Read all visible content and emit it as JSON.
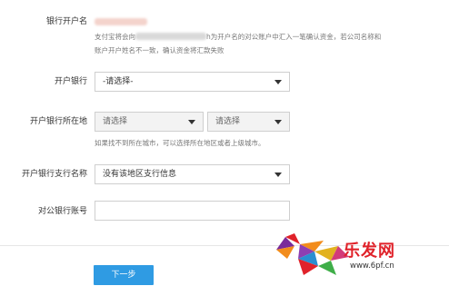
{
  "form": {
    "account_name_label": "银行开户名",
    "notice_prefix": "支付宝将会向",
    "notice_suffix": "h为开户名的对公账户中汇入一笔确认资金，若公司名称和",
    "notice_line2": "账户开户姓名不一致，确认资金将汇款失败",
    "bank_label": "开户银行",
    "bank_select": "-请选择-",
    "location_label": "开户银行所在地",
    "province_select": "请选择",
    "city_select": "请选择",
    "location_hint": "如果找不到所在城市，可以选择所在地区或者上级城市。",
    "branch_label": "开户银行支行名称",
    "branch_select": "没有该地区支行信息",
    "account_number_label": "对公银行账号",
    "account_number_value": ""
  },
  "footer": {
    "next_button": "下一步"
  },
  "watermark": {
    "brand": "乐发网",
    "url": "www.6pf.cn"
  },
  "colors": {
    "primary_button": "#2f9be3",
    "watermark_red": "#e0222a"
  }
}
